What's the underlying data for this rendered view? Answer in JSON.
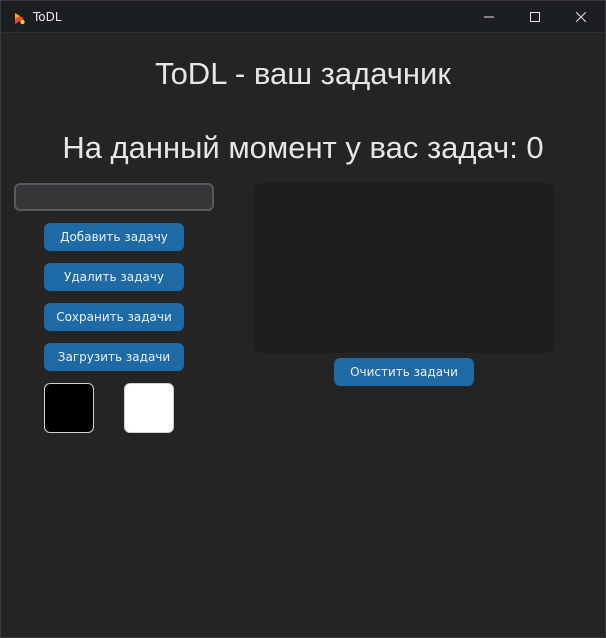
{
  "window": {
    "title": "ToDL",
    "icon": "todl-app-icon",
    "controls": [
      "minimize-icon",
      "maximize-icon",
      "close-icon"
    ]
  },
  "header": {
    "title": "ToDL - ваш задачник",
    "task_count_text": "На данный момент у вас задач: 0"
  },
  "task_input": {
    "value": "",
    "placeholder": ""
  },
  "actions": {
    "add_label": "Добавить задачу",
    "delete_label": "Удалить задачу",
    "save_label": "Сохранить задачи",
    "load_label": "Загрузить задачи",
    "clear_label": "Очистить задачи"
  },
  "theme": {
    "swatch_dark": "#000000",
    "swatch_light": "#ffffff",
    "accent": "#1f6aa5",
    "background": "#242424"
  },
  "task_list": {
    "items": []
  }
}
